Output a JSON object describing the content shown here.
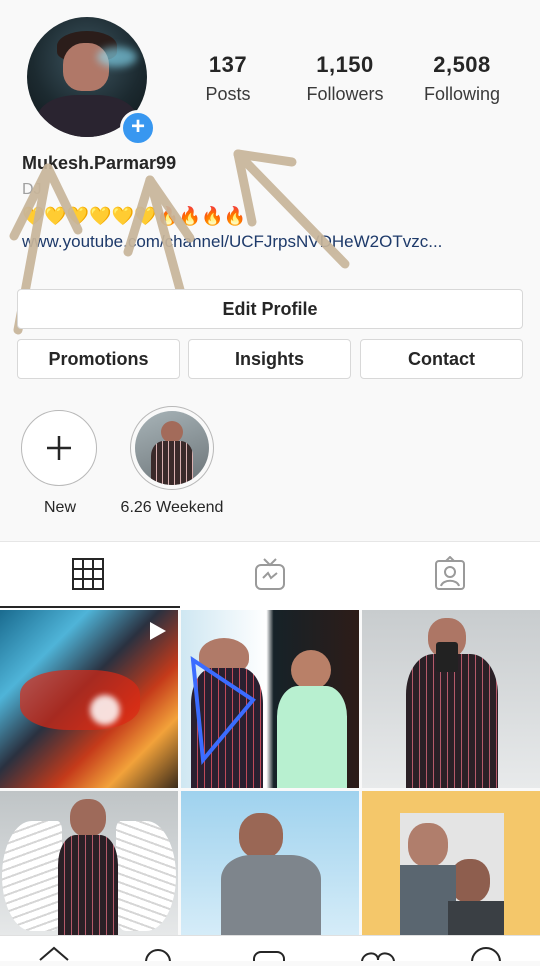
{
  "profile": {
    "username": "Mukesh.Parmar99",
    "category": "DJ",
    "bio_emojis": "💛💛💛💛💛💛🔥🔥🔥🔥",
    "link": "www.youtube.com/channel/UCFJrpsNVDHeW2OTvzc..."
  },
  "stats": [
    {
      "value": "137",
      "label": "Posts"
    },
    {
      "value": "1,150",
      "label": "Followers"
    },
    {
      "value": "2,508",
      "label": "Following"
    }
  ],
  "buttons": {
    "edit_profile": "Edit Profile",
    "promotions": "Promotions",
    "insights": "Insights",
    "contact": "Contact"
  },
  "highlights": [
    {
      "label": "New",
      "icon": "plus-icon"
    },
    {
      "label": "6.26 Weekend",
      "icon": "highlight-cover"
    }
  ],
  "tabs": [
    {
      "icon": "grid-icon",
      "active": true
    },
    {
      "icon": "igtv-icon",
      "active": false
    },
    {
      "icon": "tagged-icon",
      "active": false
    }
  ],
  "colors": {
    "accent": "#3897f0",
    "link": "#1e3a6a",
    "annotation_arrow": "#c8b59a"
  }
}
